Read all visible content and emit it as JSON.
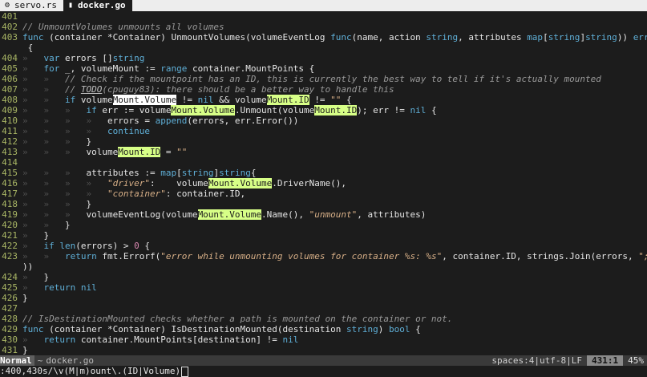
{
  "tabs": [
    {
      "icon": "gear",
      "label": "servo.rs",
      "active": false
    },
    {
      "icon": "file",
      "label": "docker.go",
      "active": true
    }
  ],
  "lines": [
    {
      "n": "401",
      "t": ""
    },
    {
      "n": "402",
      "t": "// UnmountVolumes unmounts all volumes"
    },
    {
      "n": "403",
      "t": "func (container *Container) UnmountVolumes(volumeEventLog func(name, action string, attributes map[string]string)) error"
    },
    {
      "n": "",
      "t": " {"
    },
    {
      "n": "404",
      "t": "»   var errors []string"
    },
    {
      "n": "405",
      "t": "»   for _, volumeMount := range container.MountPoints {"
    },
    {
      "n": "406",
      "t": "»   »   // Check if the mountpoint has an ID, this is currently the best way to tell if it's actually mounted"
    },
    {
      "n": "407",
      "t": "»   »   // TODO(cpuguy83): there should be a better way to handle this"
    },
    {
      "n": "408",
      "t": "»   »   if volumeMount.Volume != nil && volumeMount.ID != \"\" {"
    },
    {
      "n": "409",
      "t": "»   »   »   if err := volumeMount.Volume.Unmount(volumeMount.ID); err != nil {"
    },
    {
      "n": "410",
      "t": "»   »   »   »   errors = append(errors, err.Error())"
    },
    {
      "n": "411",
      "t": "»   »   »   »   continue"
    },
    {
      "n": "412",
      "t": "»   »   »   }"
    },
    {
      "n": "413",
      "t": "»   »   »   volumeMount.ID = \"\""
    },
    {
      "n": "414",
      "t": ""
    },
    {
      "n": "415",
      "t": "»   »   »   attributes := map[string]string{"
    },
    {
      "n": "416",
      "t": "»   »   »   »   \"driver\":    volumeMount.Volume.DriverName(),"
    },
    {
      "n": "417",
      "t": "»   »   »   »   \"container\": container.ID,"
    },
    {
      "n": "418",
      "t": "»   »   »   }"
    },
    {
      "n": "419",
      "t": "»   »   »   volumeEventLog(volumeMount.Volume.Name(), \"unmount\", attributes)"
    },
    {
      "n": "420",
      "t": "»   »   }"
    },
    {
      "n": "421",
      "t": "»   }"
    },
    {
      "n": "422",
      "t": "»   if len(errors) > 0 {"
    },
    {
      "n": "423",
      "t": "»   »   return fmt.Errorf(\"error while unmounting volumes for container %s: %s\", container.ID, strings.Join(errors, \"; \""
    },
    {
      "n": "",
      "t": "))"
    },
    {
      "n": "424",
      "t": "»   }"
    },
    {
      "n": "425",
      "t": "»   return nil"
    },
    {
      "n": "426",
      "t": "}"
    },
    {
      "n": "427",
      "t": ""
    },
    {
      "n": "428",
      "t": "// IsDestinationMounted checks whether a path is mounted on the container or not."
    },
    {
      "n": "429",
      "t": "func (container *Container) IsDestinationMounted(destination string) bool {"
    },
    {
      "n": "430",
      "t": "»   return container.MountPoints[destination] != nil"
    },
    {
      "n": "431",
      "t": "}"
    }
  ],
  "status": {
    "mode": "Normal",
    "separator": "~",
    "filename": "docker.go",
    "format": "spaces:4|utf-8|LF",
    "position": "431:1",
    "percent": "45%"
  },
  "command": ":400,430s/\\v(M|m)ount\\.(ID|Volume)",
  "colors": {
    "background": "#1c1c1c",
    "search_highlight": "#d7ff87",
    "line_number": "#a9b665",
    "keyword": "#5fafd7",
    "string": "#d7af87",
    "comment": "#9a9a9a"
  }
}
